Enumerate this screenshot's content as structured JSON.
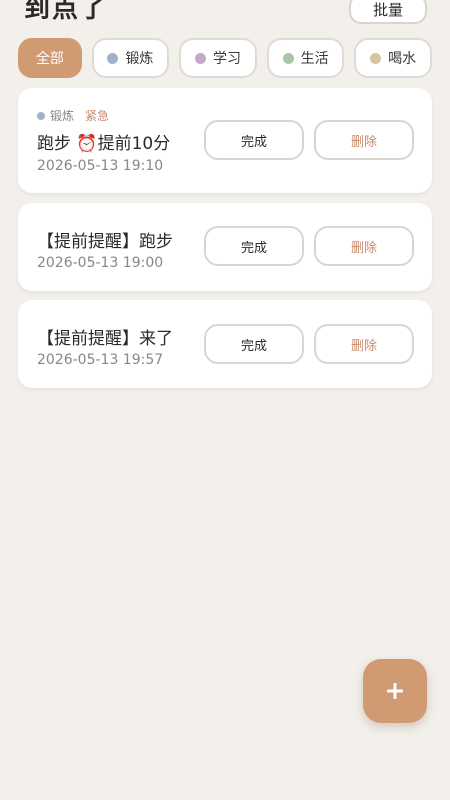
{
  "header": {
    "title": "到点了",
    "batch_label": "批量"
  },
  "filters": {
    "all_label": "全部",
    "categories": [
      {
        "label": "锻炼",
        "color": "#9fb2c8"
      },
      {
        "label": "学习",
        "color": "#c4a8c6"
      },
      {
        "label": "生活",
        "color": "#a9c6a8"
      },
      {
        "label": "喝水",
        "color": "#d6c4a2"
      }
    ],
    "active": "全部"
  },
  "reminders": [
    {
      "category": "锻炼",
      "category_color": "#9fb2c8",
      "priority": "紧急",
      "title": "跑步 ⏰提前10分",
      "time": "2026-05-13 19:10",
      "done_label": "完成",
      "delete_label": "删除"
    },
    {
      "title": "【提前提醒】跑步",
      "time": "2026-05-13 19:00",
      "done_label": "完成",
      "delete_label": "删除"
    },
    {
      "title": "【提前提醒】来了",
      "time": "2026-05-13 19:57",
      "done_label": "完成",
      "delete_label": "删除"
    }
  ],
  "fab": {
    "icon": "plus-icon"
  }
}
